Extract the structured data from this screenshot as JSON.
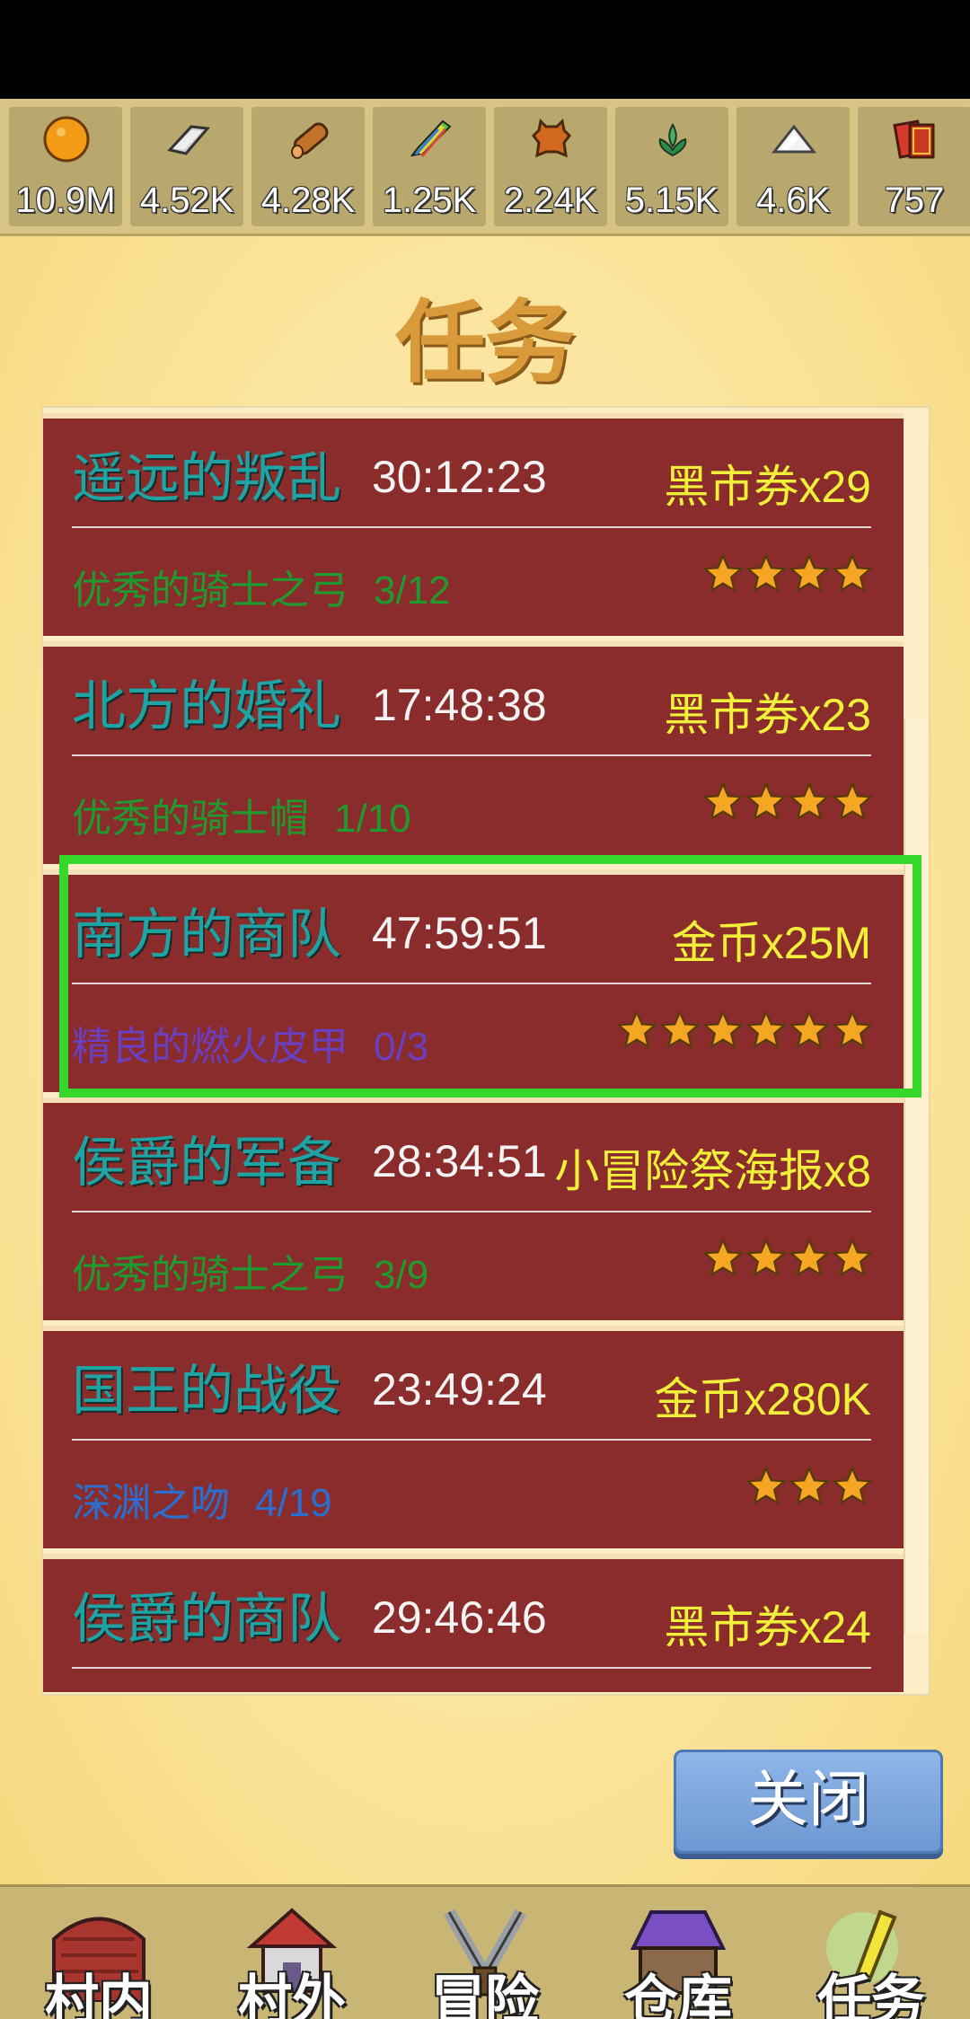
{
  "resources": [
    {
      "icon": "gold-coin-icon",
      "value": "10.9M"
    },
    {
      "icon": "iron-ingot-icon",
      "value": "4.52K"
    },
    {
      "icon": "wood-log-icon",
      "value": "4.28K"
    },
    {
      "icon": "rainbow-crystal-icon",
      "value": "1.25K"
    },
    {
      "icon": "leather-hide-icon",
      "value": "2.24K"
    },
    {
      "icon": "herb-icon",
      "value": "5.15K"
    },
    {
      "icon": "white-powder-icon",
      "value": "4.6K"
    },
    {
      "icon": "ticket-cards-icon",
      "value": "757"
    }
  ],
  "title": "任务",
  "quests": [
    {
      "name": "遥远的叛乱",
      "time": "30:12:23",
      "reward": "黑市券x29",
      "requirement": "优秀的骑士之弓",
      "count": "3/12",
      "req_color": "#1e9a2e",
      "stars": 4
    },
    {
      "name": "北方的婚礼",
      "time": "17:48:38",
      "reward": "黑市券x23",
      "requirement": "优秀的骑士帽",
      "count": "1/10",
      "req_color": "#1e9a2e",
      "stars": 4
    },
    {
      "name": "南方的商队",
      "time": "47:59:51",
      "reward": "金币x25M",
      "requirement": "精良的燃火皮甲",
      "count": "0/3",
      "req_color": "#6a3fc0",
      "stars": 6
    },
    {
      "name": "侯爵的军备",
      "time": "28:34:51",
      "reward": "小冒险祭海报x8",
      "requirement": "优秀的骑士之弓",
      "count": "3/9",
      "req_color": "#1e9a2e",
      "stars": 4
    },
    {
      "name": "国王的战役",
      "time": "23:49:24",
      "reward": "金币x280K",
      "requirement": "深渊之吻",
      "count": "4/19",
      "req_color": "#2a6fd0",
      "stars": 3
    },
    {
      "name": "侯爵的商队",
      "time": "29:46:46",
      "reward": "黑市券x24",
      "requirement": "",
      "count": "",
      "req_color": "#1e9a2e",
      "stars": 0
    }
  ],
  "close_label": "关闭",
  "nav": [
    {
      "label": "村内",
      "icon": "village-inside-icon"
    },
    {
      "label": "村外",
      "icon": "village-outside-icon"
    },
    {
      "label": "冒险",
      "icon": "adventure-icon"
    },
    {
      "label": "仓库",
      "icon": "warehouse-icon"
    },
    {
      "label": "任务",
      "icon": "quest-icon"
    }
  ],
  "colors": {
    "quest_bg": "#8b2c2c",
    "quest_name": "#1fa3a3",
    "reward": "#f0ef3a",
    "highlight": "#35d82a",
    "title": "#d99a3c"
  }
}
